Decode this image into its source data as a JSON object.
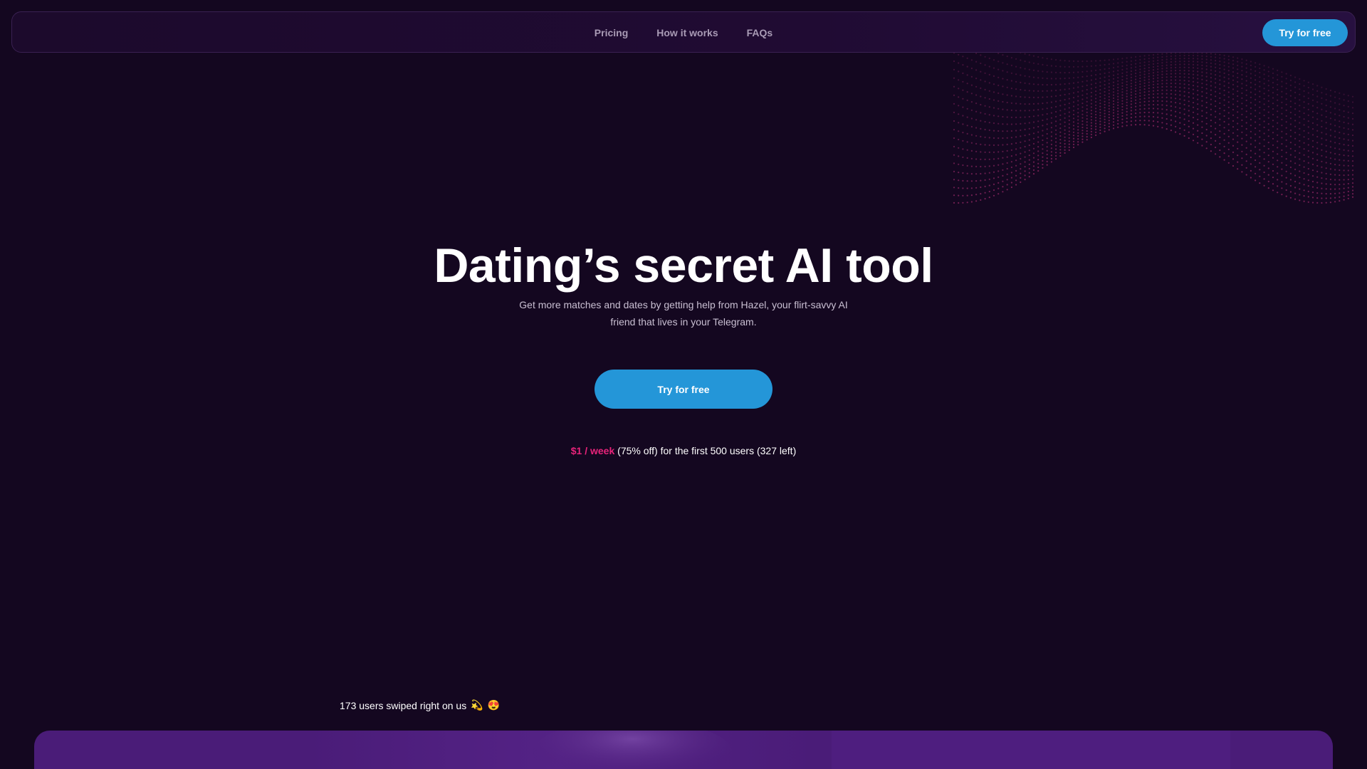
{
  "colors": {
    "background": "#140720",
    "accent_blue": "#2496d8",
    "price_pink": "#e8237a",
    "panel_purple": "#4a1c78"
  },
  "nav": {
    "links": [
      "Pricing",
      "How it works",
      "FAQs"
    ],
    "cta_label": "Try for free"
  },
  "hero": {
    "title": "Dating’s secret AI tool",
    "subtitle": "Get more matches and dates by getting help from  Hazel, your flirt-savvy AI friend that lives in your Telegram.",
    "cta_label": "Try for free"
  },
  "offer": {
    "price": "$1 / week",
    "rest": " (75% off) for the first 500 users (327 left)"
  },
  "social_proof": {
    "text": "173 users swiped right on us",
    "emoji_1": "💫",
    "emoji_2": "😍"
  },
  "icons": {
    "decoration": "dotted-wave-graphic"
  }
}
